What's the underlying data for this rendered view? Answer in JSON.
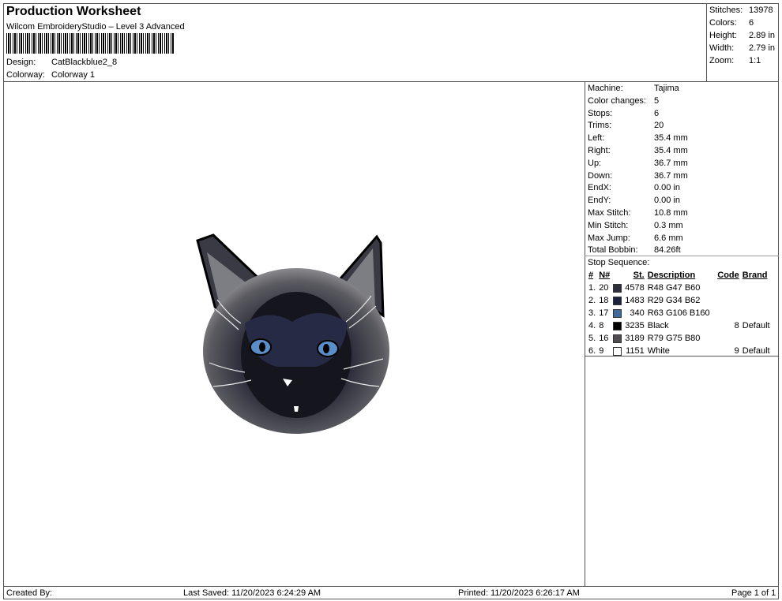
{
  "header": {
    "title": "Production Worksheet",
    "subtitle": "Wilcom EmbroideryStudio – Level 3 Advanced",
    "design_label": "Design:",
    "design_value": "CatBlackblue2_8",
    "colorway_label": "Colorway:",
    "colorway_value": "Colorway 1"
  },
  "summary": [
    {
      "label": "Stitches:",
      "value": "13978"
    },
    {
      "label": "Colors:",
      "value": "6"
    },
    {
      "label": "Height:",
      "value": "2.89 in"
    },
    {
      "label": "Width:",
      "value": "2.79 in"
    },
    {
      "label": "Zoom:",
      "value": "1:1"
    }
  ],
  "machine_info": [
    {
      "label": "Machine:",
      "value": "Tajima"
    },
    {
      "label": "Color changes:",
      "value": "5"
    },
    {
      "label": "Stops:",
      "value": "6"
    },
    {
      "label": "Trims:",
      "value": "20"
    },
    {
      "label": "Left:",
      "value": "35.4 mm"
    },
    {
      "label": "Right:",
      "value": "35.4 mm"
    },
    {
      "label": "Up:",
      "value": "36.7 mm"
    },
    {
      "label": "Down:",
      "value": "36.7 mm"
    },
    {
      "label": "EndX:",
      "value": "0.00 in"
    },
    {
      "label": "EndY:",
      "value": "0.00 in"
    },
    {
      "label": "Max Stitch:",
      "value": "10.8 mm"
    },
    {
      "label": "Min Stitch:",
      "value": "0.3 mm"
    },
    {
      "label": "Max Jump:",
      "value": "6.6 mm"
    },
    {
      "label": "Total Bobbin:",
      "value": "84.26ft"
    }
  ],
  "stop_sequence": {
    "title": "Stop Sequence:",
    "headers": {
      "num": "#",
      "needle": "N#",
      "stitches": "St.",
      "description": "Description",
      "code": "Code",
      "brand": "Brand"
    },
    "rows": [
      {
        "num": "1.",
        "needle": "20",
        "color": "#302F3C",
        "stitches": "4578",
        "description": "R48 G47 B60",
        "code": "",
        "brand": ""
      },
      {
        "num": "2.",
        "needle": "18",
        "color": "#1D223E",
        "stitches": "1483",
        "description": "R29 G34 B62",
        "code": "",
        "brand": ""
      },
      {
        "num": "3.",
        "needle": "17",
        "color": "#3F6AA0",
        "stitches": "340",
        "description": "R63 G106 B160",
        "code": "",
        "brand": ""
      },
      {
        "num": "4.",
        "needle": "8",
        "color": "#000000",
        "stitches": "3235",
        "description": "Black",
        "code": "8",
        "brand": "Default"
      },
      {
        "num": "5.",
        "needle": "16",
        "color": "#4F4B50",
        "stitches": "3189",
        "description": "R79 G75 B80",
        "code": "",
        "brand": ""
      },
      {
        "num": "6.",
        "needle": "9",
        "color": "#FFFFFF",
        "stitches": "1151",
        "description": "White",
        "code": "9",
        "brand": "Default"
      }
    ]
  },
  "footer": {
    "created_by": "Created By:",
    "last_saved": "Last Saved: 11/20/2023 6:24:29 AM",
    "printed": "Printed: 11/20/2023 6:26:17 AM",
    "page": "Page 1 of 1"
  }
}
